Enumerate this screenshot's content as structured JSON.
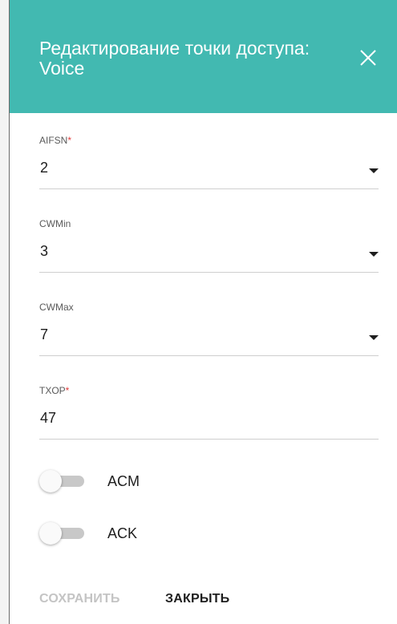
{
  "dialog": {
    "title": "Редактирование точки доступа: Voice",
    "accent_color": "#42b9b1"
  },
  "fields": [
    {
      "label": "AIFSN",
      "required": true,
      "value": "2",
      "type": "select"
    },
    {
      "label": "CWMin",
      "required": false,
      "value": "3",
      "type": "select"
    },
    {
      "label": "CWMax",
      "required": false,
      "value": "7",
      "type": "select"
    },
    {
      "label": "TXOP",
      "required": true,
      "value": "47",
      "type": "text"
    }
  ],
  "toggles": [
    {
      "label": "ACM",
      "on": false
    },
    {
      "label": "ACK",
      "on": false
    }
  ],
  "actions": {
    "save_label": "СОХРАНИТЬ",
    "close_label": "ЗАКРЫТЬ"
  },
  "required_mark": "*"
}
